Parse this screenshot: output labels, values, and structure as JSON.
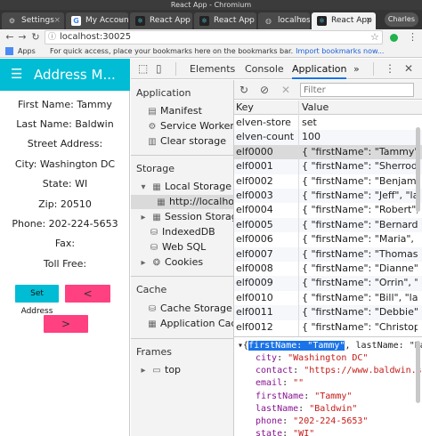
{
  "window": {
    "title": "React App - Chromium"
  },
  "tabs": [
    {
      "label": "Settings",
      "icon": "gear-icon"
    },
    {
      "label": "My Accoun",
      "icon": "google-icon"
    },
    {
      "label": "React App",
      "icon": "react-icon"
    },
    {
      "label": "React App",
      "icon": "react-icon"
    },
    {
      "label": "localhost",
      "icon": "globe-icon"
    },
    {
      "label": "React App",
      "icon": "react-icon",
      "active": true
    }
  ],
  "profile": "Charles",
  "address": {
    "url": "localhost:30025"
  },
  "bookmarks": {
    "apps_label": "Apps",
    "prompt": "For quick access, place your bookmarks here on the bookmarks bar.",
    "import_link": "Import bookmarks now..."
  },
  "app": {
    "title": "Address M...",
    "fields": [
      "First Name: Tammy",
      "Last Name: Baldwin",
      "Street Address:",
      "City: Washington DC",
      "State: WI",
      "Zip: 20510",
      "Phone: 202-224-5653",
      "Fax:",
      "Toll Free:"
    ],
    "buttons": {
      "set": "Set Address",
      "prev": "<",
      "next": ">"
    },
    "colors": {
      "header": "#00bcd4",
      "accent": "#ff4081"
    }
  },
  "devtools": {
    "tabs": [
      "Elements",
      "Console",
      "Application"
    ],
    "active_tab": "Application",
    "more": "»",
    "sidebar": {
      "application_heading": "Application",
      "application_items": [
        "Manifest",
        "Service Workers",
        "Clear storage"
      ],
      "storage_heading": "Storage",
      "local_storage": "Local Storage",
      "local_storage_origin": "http://localhost",
      "session_storage": "Session Storage",
      "indexeddb": "IndexedDB",
      "websql": "Web SQL",
      "cookies": "Cookies",
      "cache_heading": "Cache",
      "cache_items": [
        "Cache Storage",
        "Application Cache"
      ],
      "frames_heading": "Frames",
      "frames_top": "top"
    },
    "filter_placeholder": "Filter",
    "table": {
      "headers": {
        "key": "Key",
        "value": "Value"
      },
      "rows": [
        {
          "key": "elven-store",
          "value": "set"
        },
        {
          "key": "elven-count",
          "value": "100"
        },
        {
          "key": "elf0000",
          "value": "{ \"firstName\": \"Tammy\",",
          "selected": true
        },
        {
          "key": "elf0001",
          "value": "{ \"firstName\": \"Sherrod\""
        },
        {
          "key": "elf0002",
          "value": "{ \"firstName\": \"Benjami"
        },
        {
          "key": "elf0003",
          "value": "{ \"firstName\": \"Jeff\", \"la"
        },
        {
          "key": "elf0004",
          "value": "{ \"firstName\": \"Robert\","
        },
        {
          "key": "elf0005",
          "value": "{ \"firstName\": \"Bernard\""
        },
        {
          "key": "elf0006",
          "value": "{ \"firstName\": \"Maria\", \""
        },
        {
          "key": "elf0007",
          "value": "{ \"firstName\": \"Thomas\""
        },
        {
          "key": "elf0008",
          "value": "{ \"firstName\": \"Dianne\","
        },
        {
          "key": "elf0009",
          "value": "{ \"firstName\": \"Orrin\", \"l"
        },
        {
          "key": "elf0010",
          "value": "{ \"firstName\": \"Bill\", \"la"
        },
        {
          "key": "elf0011",
          "value": "{ \"firstName\": \"Debbie\","
        },
        {
          "key": "elf0012",
          "value": "{ \"firstName\": \"Christop"
        }
      ]
    },
    "preview": {
      "first": {
        "key": "firstName",
        "value": "\"Tammy\"",
        "rest": "lastName: \"Ba"
      },
      "lines": [
        {
          "key": "city",
          "value": "\"Washington DC\""
        },
        {
          "key": "contact",
          "value": "\"https://www.baldwin.se"
        },
        {
          "key": "email",
          "value": "\"\""
        },
        {
          "key": "firstName",
          "value": "\"Tammy\""
        },
        {
          "key": "lastName",
          "value": "\"Baldwin\""
        },
        {
          "key": "phone",
          "value": "\"202-224-5653\""
        },
        {
          "key": "state",
          "value": "\"WI\""
        }
      ]
    }
  }
}
